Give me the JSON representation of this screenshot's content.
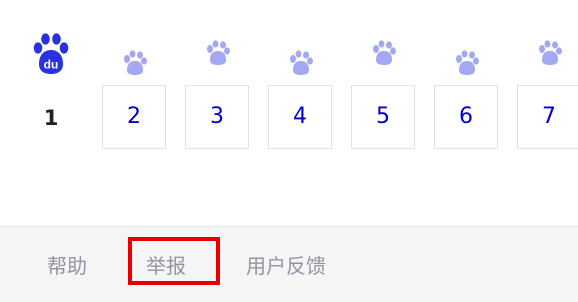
{
  "pagination": {
    "current_page": "1",
    "pages": [
      "2",
      "3",
      "4",
      "5",
      "6",
      "7"
    ],
    "logo_text": "du",
    "colors": {
      "logo_blue": "#2932e1",
      "paw_light": "#a3a8f0",
      "page_link": "#0000cc",
      "current_text": "#222222"
    }
  },
  "footer": {
    "links": [
      "帮助",
      "举报",
      "用户反馈"
    ],
    "highlight_color": "#e60000"
  }
}
